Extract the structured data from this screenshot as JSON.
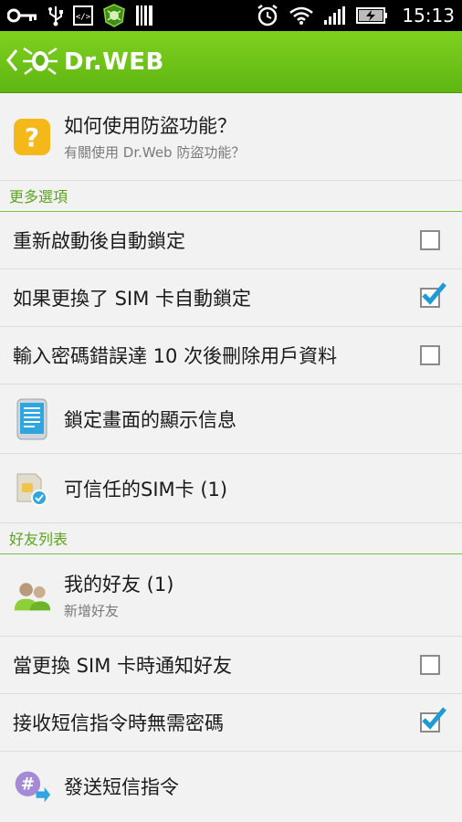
{
  "status_bar": {
    "time": "15:13",
    "left_icons": [
      "key-icon",
      "usb-icon",
      "code-icon",
      "drweb-spider-icon",
      "barcode-icon"
    ],
    "right_icons": [
      "alarm-icon",
      "wifi-icon",
      "signal-icon",
      "battery-charging-icon"
    ]
  },
  "action_bar": {
    "brand": "Dr.WEB",
    "accent": "#6cc417"
  },
  "help": {
    "title": "如何使用防盜功能？",
    "subtitle": "有關使用 Dr.Web 防盜功能？"
  },
  "more_options": {
    "header": "更多選項",
    "items": [
      {
        "label": "重新啟動後自動鎖定",
        "checked": false
      },
      {
        "label": "如果更換了 SIM 卡自動鎖定",
        "checked": true
      },
      {
        "label": "輸入密碼錯誤達 10 次後刪除用戶資料",
        "checked": false
      }
    ],
    "lock_screen_info": "鎖定畫面的顯示信息",
    "trusted_sim": "可信任的SIM卡 (1)"
  },
  "friends": {
    "header": "好友列表",
    "my_friends_title": "我的好友 (1)",
    "my_friends_subtitle": "新增好友",
    "items": [
      {
        "label": "當更換 SIM 卡時通知好友",
        "checked": false
      },
      {
        "label": "接收短信指令時無需密碼",
        "checked": true
      }
    ],
    "send_sms": "發送短信指令"
  }
}
